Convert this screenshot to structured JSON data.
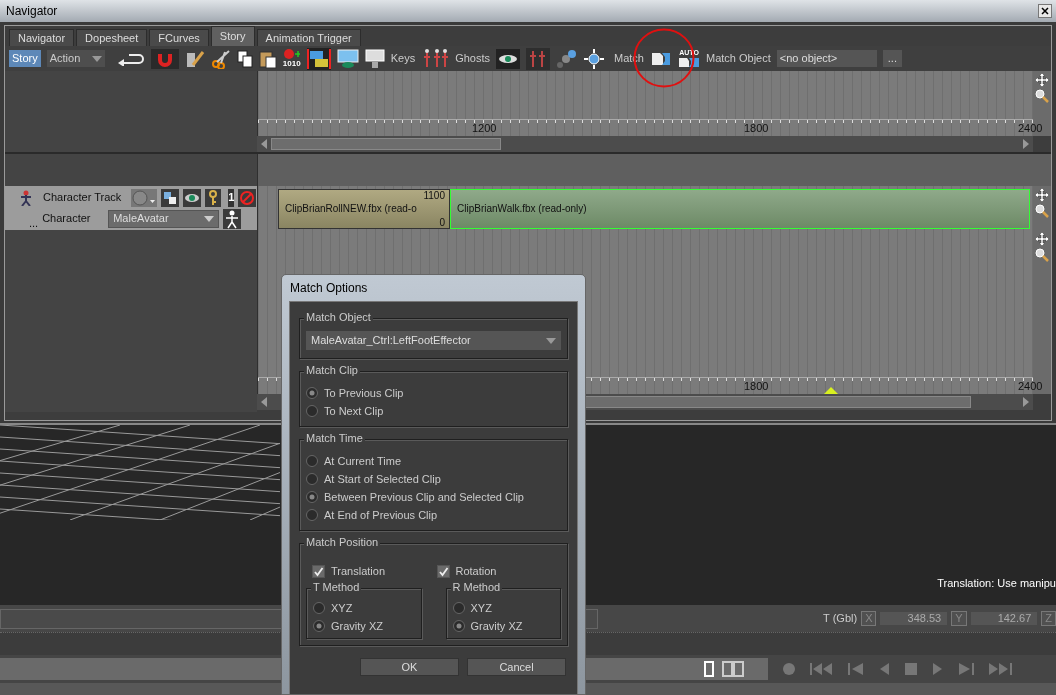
{
  "window": {
    "title": "Navigator"
  },
  "tabs": [
    {
      "label": "Navigator",
      "selected": false
    },
    {
      "label": "Dopesheet",
      "selected": false
    },
    {
      "label": "FCurves",
      "selected": false
    },
    {
      "label": "Story",
      "selected": true
    },
    {
      "label": "Animation Trigger",
      "selected": false
    }
  ],
  "toolbar": {
    "modes": [
      {
        "label": "Story",
        "selected": true
      },
      {
        "label": "Action",
        "selected": false
      }
    ],
    "record_caption": "1010",
    "keys_label": "Keys",
    "ghosts_label": "Ghosts",
    "match_label": "Match",
    "match_circled": true,
    "auto_caption": "AUTO",
    "match_object_label": "Match Object",
    "match_object_value": "<no object>",
    "browse_button": "..."
  },
  "upper_ruler": [
    "1200",
    "1800",
    "2400"
  ],
  "track": {
    "name": "Character Track",
    "number_button": "1",
    "more": "...",
    "character_label": "Character",
    "character_value": "MaleAvatar"
  },
  "clips": [
    {
      "name": "ClipBrianRollNEW.fbx (read-o",
      "selected": false,
      "top_value": "1100",
      "bottom_value": "0"
    },
    {
      "name": "ClipBrianWalk.fbx (read-only)",
      "selected": true
    }
  ],
  "lower_ruler": [
    "1800",
    "2400"
  ],
  "viewport": {
    "message": "Translation: Use manipu"
  },
  "transform": {
    "label": "T (Gbl)",
    "fields": [
      {
        "axis": "X",
        "value": "348.53"
      },
      {
        "axis": "Y",
        "value": "142.67"
      },
      {
        "axis": "Z"
      }
    ]
  },
  "dialog": {
    "title": "Match Options",
    "match_object": {
      "legend": "Match Object",
      "value": "MaleAvatar_Ctrl:LeftFootEffector"
    },
    "match_clip": {
      "legend": "Match Clip",
      "options": [
        {
          "label": "To Previous Clip",
          "selected": true
        },
        {
          "label": "To Next Clip",
          "selected": false
        }
      ]
    },
    "match_time": {
      "legend": "Match Time",
      "options": [
        {
          "label": "At Current Time",
          "selected": false
        },
        {
          "label": "At Start of Selected Clip",
          "selected": false
        },
        {
          "label": "Between Previous Clip and Selected Clip",
          "selected": true
        },
        {
          "label": "At End of Previous Clip",
          "selected": false
        }
      ]
    },
    "match_position": {
      "legend": "Match Position",
      "checks": [
        {
          "label": "Translation",
          "checked": true
        },
        {
          "label": "Rotation",
          "checked": true
        }
      ],
      "methods": [
        {
          "legend": "T Method",
          "options": [
            {
              "label": "XYZ",
              "selected": false
            },
            {
              "label": "Gravity XZ",
              "selected": true
            }
          ]
        },
        {
          "legend": "R Method",
          "options": [
            {
              "label": "XYZ",
              "selected": false
            },
            {
              "label": "Gravity XZ",
              "selected": true
            }
          ]
        }
      ]
    },
    "buttons": [
      "OK",
      "Cancel"
    ]
  }
}
